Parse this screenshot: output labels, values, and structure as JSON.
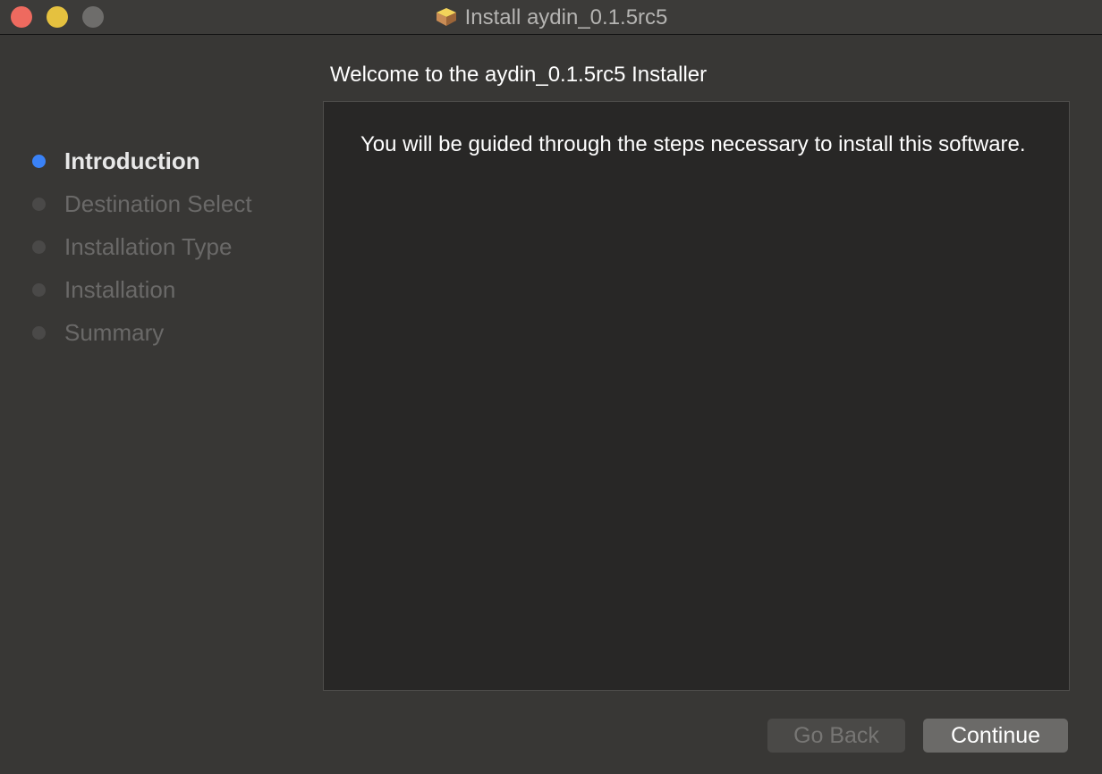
{
  "window": {
    "title": "Install aydin_0.1.5rc5",
    "icon": "package-icon"
  },
  "heading": "Welcome to the aydin_0.1.5rc5 Installer",
  "body_text": "You will be guided through the steps necessary to install this software.",
  "steps": [
    {
      "label": "Introduction",
      "active": true
    },
    {
      "label": "Destination Select",
      "active": false
    },
    {
      "label": "Installation Type",
      "active": false
    },
    {
      "label": "Installation",
      "active": false
    },
    {
      "label": "Summary",
      "active": false
    }
  ],
  "buttons": {
    "back": "Go Back",
    "continue": "Continue"
  },
  "colors": {
    "active_step": "#3a82f7",
    "close": "#ee6a5f",
    "minimize": "#e5c13f",
    "zoom": "#6e6d6b"
  }
}
